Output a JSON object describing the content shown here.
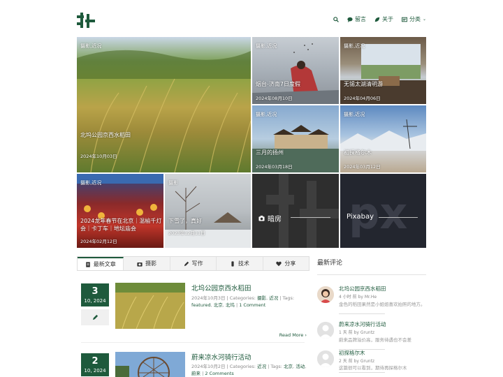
{
  "header": {
    "nav": [
      {
        "icon": "search-icon",
        "label": ""
      },
      {
        "icon": "comment-icon",
        "label": "留言"
      },
      {
        "icon": "leaf-icon",
        "label": "关于"
      },
      {
        "icon": "folder-icon",
        "label": "分类"
      }
    ]
  },
  "mosaic": {
    "big": {
      "category": "摄影,近况",
      "title": "北坞公园京西水稻田",
      "date": "2024年10月03日"
    },
    "t1": {
      "category": "摄影,近况",
      "title": "烟台-济南7日度假",
      "date": "2024年08月10日"
    },
    "t2": {
      "category": "摄影,近况",
      "title": "无锡太湖清明游",
      "date": "2024年04月06日"
    },
    "t3": {
      "category": "摄影,近况",
      "title": "三月的扬州",
      "date": "2024年03月18日"
    },
    "t4": {
      "category": "摄影,近况",
      "title": "初探格尔木",
      "date": "2024年03月12日"
    },
    "t5": {
      "category": "摄影,近况",
      "title1": "2024龙年春节在北京｜温榆千灯",
      "title2": "会｜卡丁车｜地坛庙会",
      "date": "2024年02月12日"
    },
    "t6": {
      "category": "摄影",
      "title": "下雪了，真好",
      "date": "2023年12月11日"
    },
    "t7": {
      "label": "暗房"
    },
    "t8": {
      "label": "Pixabay"
    }
  },
  "tabs": [
    {
      "icon": "document-icon",
      "label": "最新文章"
    },
    {
      "icon": "camera-icon",
      "label": "摄影"
    },
    {
      "icon": "pen-icon",
      "label": "写作"
    },
    {
      "icon": "tech-icon",
      "label": "技术"
    },
    {
      "icon": "heart-icon",
      "label": "分享"
    }
  ],
  "posts": [
    {
      "day": "3",
      "month": "10, 2024",
      "title": "北坞公园京西水稻田",
      "meta_prefix": "2024年10月3日 | Categories: ",
      "cat1": "摄影",
      "cat2": "近况",
      "tags_prefix": " | Tags: ",
      "tag1": "featured",
      "tag2": "北京",
      "tag3": "北坞",
      "comments": "1 Comment",
      "readmore": "Read More"
    },
    {
      "day": "2",
      "month": "10, 2024",
      "title": "蔚来凉水河骑行活动",
      "meta_prefix": "2024年10月2日 | Categories: ",
      "cat1": "近况",
      "tags_prefix": " | Tags: ",
      "tag1": "北京",
      "tag2": "活动",
      "tag3": "蔚来",
      "comments": "2 Comments"
    }
  ],
  "sidebar": {
    "title": "最新评论",
    "comments": [
      {
        "post": "北坞公园京西水稻田",
        "time": "4 小时 前",
        "by": "by",
        "author": "Mr.He",
        "excerpt": "金色的稻田果然是小姐姐喜欢拍照的地方。"
      },
      {
        "post": "蔚来凉水河骑行活动",
        "time": "1 天 前",
        "by": "by",
        "author": "Gruntz",
        "excerpt": "蔚来品牌溢价高，服务待遇也不会差"
      },
      {
        "post": "初探格尔木",
        "time": "2 天 前",
        "by": "by",
        "author": "Gruntz",
        "excerpt": "这篇很可以看到，期待再探格尔木"
      }
    ]
  },
  "colors": {
    "accent": "#1e5a3c"
  }
}
